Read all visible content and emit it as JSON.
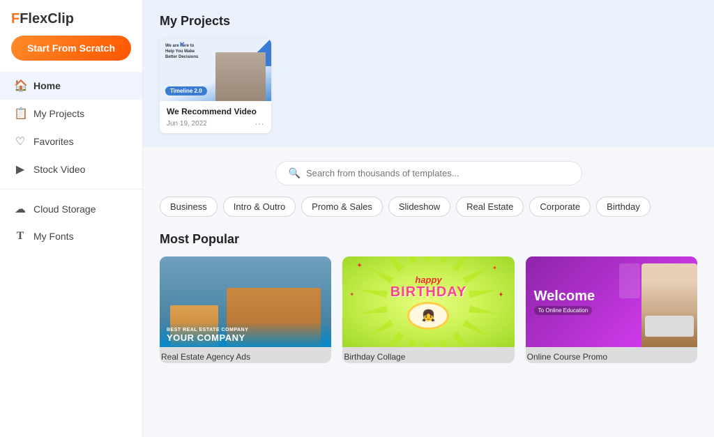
{
  "app": {
    "logo": "FlexClip",
    "logo_f": "F"
  },
  "sidebar": {
    "start_btn": "Start From Scratch",
    "nav_items": [
      {
        "id": "home",
        "label": "Home",
        "icon": "🏠",
        "active": true
      },
      {
        "id": "my-projects",
        "label": "My Projects",
        "icon": "📋",
        "active": false
      },
      {
        "id": "favorites",
        "label": "Favorites",
        "icon": "♡",
        "active": false
      },
      {
        "id": "stock-video",
        "label": "Stock Video",
        "icon": "▶",
        "active": false
      }
    ],
    "nav_items2": [
      {
        "id": "cloud-storage",
        "label": "Cloud Storage",
        "icon": "☁"
      },
      {
        "id": "my-fonts",
        "label": "My Fonts",
        "icon": "T"
      }
    ]
  },
  "projects": {
    "section_title": "My Projects",
    "items": [
      {
        "name": "We Recommend Video",
        "date": "Jun 19, 2022",
        "badge": "Timeline 2.0"
      }
    ]
  },
  "search": {
    "placeholder": "Search from thousands of templates..."
  },
  "categories": [
    {
      "id": "business",
      "label": "Business"
    },
    {
      "id": "intro-outro",
      "label": "Intro & Outro"
    },
    {
      "id": "promo-sales",
      "label": "Promo & Sales"
    },
    {
      "id": "slideshow",
      "label": "Slideshow"
    },
    {
      "id": "real-estate",
      "label": "Real Estate"
    },
    {
      "id": "corporate",
      "label": "Corporate"
    },
    {
      "id": "birthday",
      "label": "Birthday"
    }
  ],
  "most_popular": {
    "title": "Most Popular",
    "templates": [
      {
        "id": "real-estate",
        "label": "Real Estate Agency Ads",
        "company_line": "BEST REAL ESTATE COMPANY",
        "company_name": "YOUR COMPANY"
      },
      {
        "id": "birthday",
        "label": "Birthday Collage",
        "happy": "happy",
        "birthday": "BIRTHDAY"
      },
      {
        "id": "online-course",
        "label": "Online Course Promo",
        "welcome": "Welcome",
        "sub": "To Online Education"
      }
    ]
  }
}
